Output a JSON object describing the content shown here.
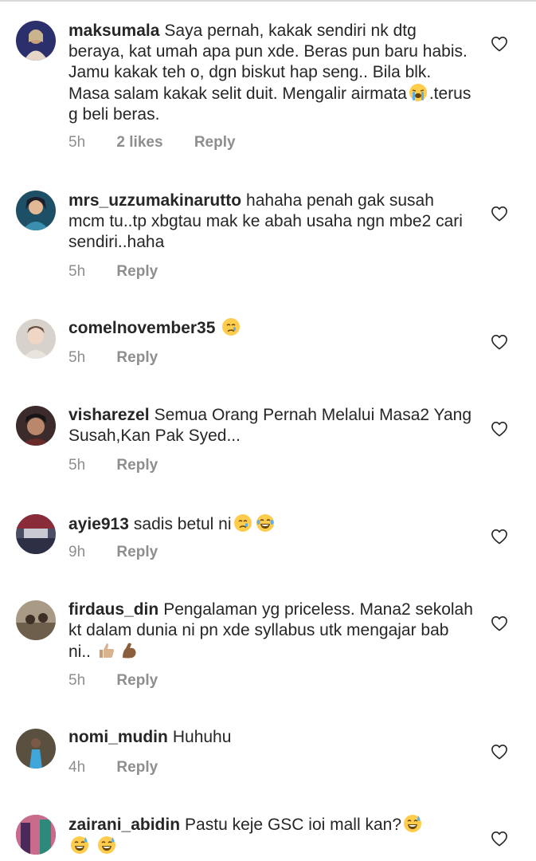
{
  "comments": [
    {
      "username": "maksumala",
      "text": "Saya pernah, kakak sendiri nk dtg beraya, kat umah apa pun xde. Beras pun baru habis. Jamu kakak teh o, dgn biskut hap seng.. Bila blk. Masa salam kakak selit duit. Mengalir airmata",
      "text2": ".terus g beli beras.",
      "emoji": "loudly-crying-face",
      "time": "5h",
      "likes": "2 likes",
      "reply": "Reply"
    },
    {
      "username": "mrs_uzzumakinarutto",
      "text": "hahaha penah gak susah mcm tu..tp xbgtau mak ke abah usaha ngn mbe2 cari sendiri..haha",
      "time": "5h",
      "reply": "Reply"
    },
    {
      "username": "comelnovember35",
      "text": "",
      "emoji": "crying-face",
      "time": "5h",
      "reply": "Reply"
    },
    {
      "username": "visharezel",
      "text": "Semua Orang Pernah Melalui Masa2 Yang Susah,Kan Pak Syed...",
      "time": "5h",
      "reply": "Reply"
    },
    {
      "username": "ayie913",
      "text": "sadis betul ni",
      "emoji": "crying-face",
      "emoji2": "tears-of-joy-face",
      "time": "9h",
      "reply": "Reply"
    },
    {
      "username": "firdaus_din",
      "text": "Pengalaman yg priceless. Mana2 sekolah kt dalam dunia ni pn xde syllabus utk mengajar bab ni..",
      "emoji": "thumbs-up",
      "emoji2": "flexed-biceps",
      "time": "5h",
      "reply": "Reply"
    },
    {
      "username": "nomi_mudin",
      "text": "Huhuhu",
      "time": "4h",
      "reply": "Reply"
    },
    {
      "username": "zairani_abidin",
      "text": "Pastu keje GSC ioi mall kan?",
      "emoji": "grinning-sweat-face",
      "time": "",
      "reply": ""
    }
  ]
}
